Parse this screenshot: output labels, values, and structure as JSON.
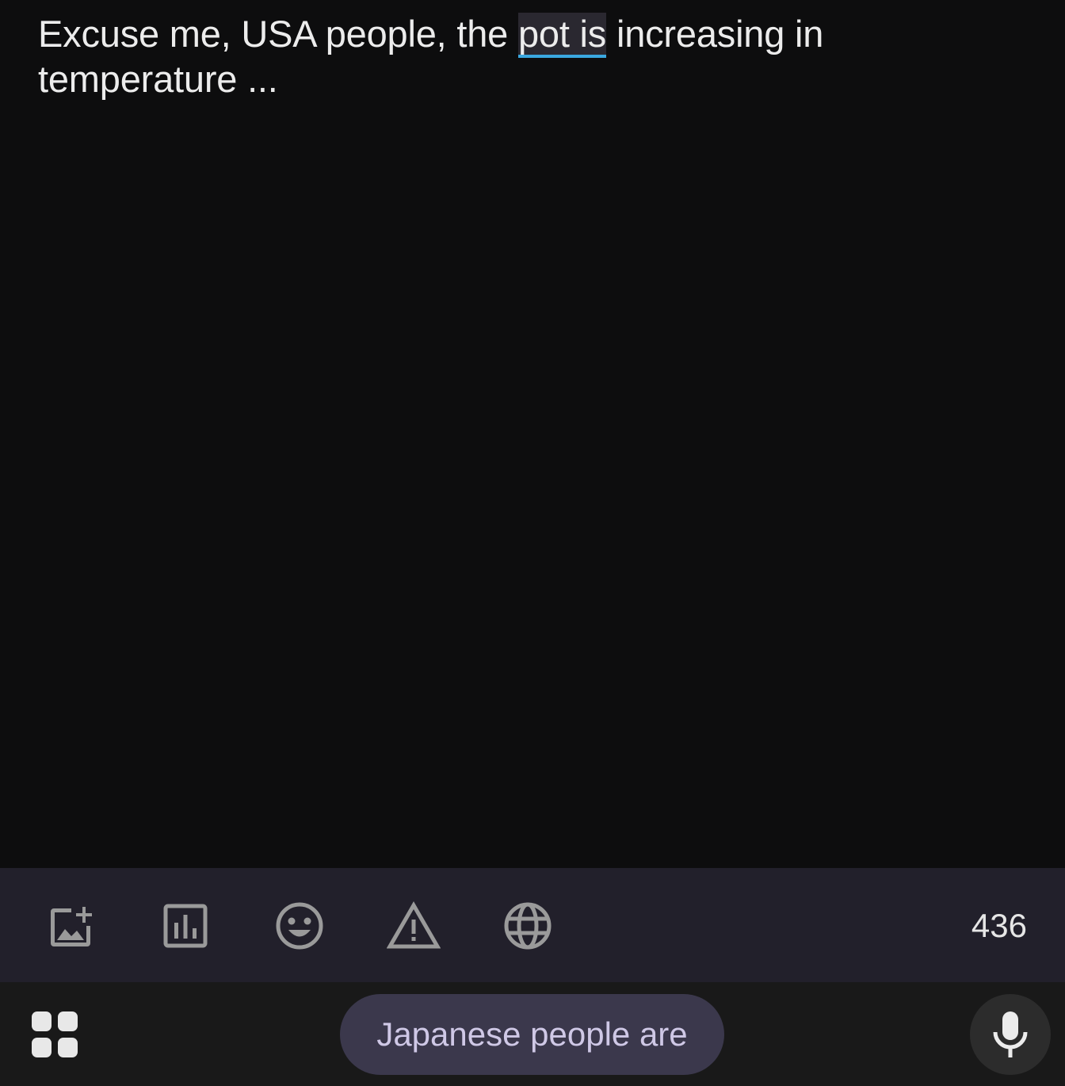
{
  "compose": {
    "text_before": "Excuse me, USA people, the ",
    "composing_word": "pot is",
    "text_after": " increasing in temperature ..."
  },
  "toolbar": {
    "tools": [
      {
        "name": "add-image",
        "icon": "image-add-icon"
      },
      {
        "name": "poll",
        "icon": "bar-chart-icon"
      },
      {
        "name": "emoji",
        "icon": "smiley-icon"
      },
      {
        "name": "content-warning",
        "icon": "warning-triangle-icon"
      },
      {
        "name": "visibility",
        "icon": "globe-icon"
      }
    ],
    "char_remaining": "436"
  },
  "keyboard": {
    "suggestion": "Japanese people are",
    "menu_icon": "apps-grid-icon",
    "voice_icon": "microphone-icon"
  },
  "colors": {
    "background": "#0d0d0e",
    "toolbar": "#22202b",
    "keyboard": "#191919",
    "suggestion_chip": "#3b384c",
    "composing_underline": "#3aa8e0"
  }
}
